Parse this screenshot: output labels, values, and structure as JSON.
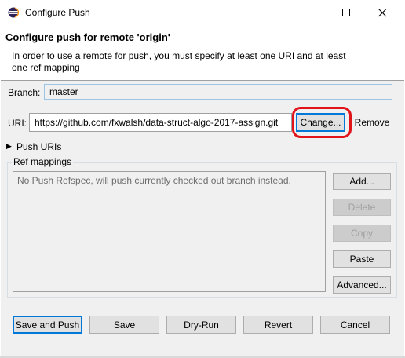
{
  "window": {
    "title": "Configure Push",
    "controls": {
      "minimize": "─",
      "maximize": "☐",
      "close": "✕"
    }
  },
  "header": {
    "title": "Configure push for remote 'origin'",
    "description": "In order to use a remote for push, you must specify at least one URI and at least one ref mapping"
  },
  "branch": {
    "label": "Branch:",
    "value": "master"
  },
  "uri": {
    "label": "URI:",
    "value": "https://github.com/fxwalsh/data-struct-algo-2017-assign.git",
    "change_button": "Change...",
    "remove_button": "Remove"
  },
  "push_uris": {
    "label": "Push URIs",
    "expander": "▶"
  },
  "ref_mappings": {
    "label": "Ref mappings",
    "empty_text": "No Push Refspec, will push currently checked out branch instead.",
    "buttons": {
      "add": "Add...",
      "delete": "Delete",
      "copy": "Copy",
      "paste": "Paste",
      "advanced": "Advanced..."
    }
  },
  "footer": {
    "save_and_push": "Save and Push",
    "save": "Save",
    "dry_run": "Dry-Run",
    "revert": "Revert",
    "cancel": "Cancel"
  },
  "colors": {
    "accent": "#0078d7",
    "highlight": "#e0141a",
    "disabled_text": "#a0a0a0"
  }
}
